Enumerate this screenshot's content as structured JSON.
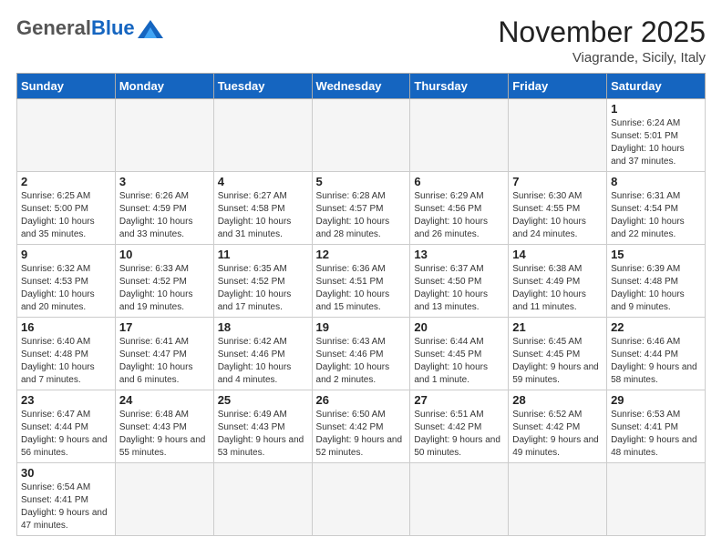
{
  "header": {
    "logo_general": "General",
    "logo_blue": "Blue",
    "month_title": "November 2025",
    "location": "Viagrande, Sicily, Italy"
  },
  "weekdays": [
    "Sunday",
    "Monday",
    "Tuesday",
    "Wednesday",
    "Thursday",
    "Friday",
    "Saturday"
  ],
  "weeks": [
    [
      {
        "day": "",
        "info": ""
      },
      {
        "day": "",
        "info": ""
      },
      {
        "day": "",
        "info": ""
      },
      {
        "day": "",
        "info": ""
      },
      {
        "day": "",
        "info": ""
      },
      {
        "day": "",
        "info": ""
      },
      {
        "day": "1",
        "info": "Sunrise: 6:24 AM\nSunset: 5:01 PM\nDaylight: 10 hours\nand 37 minutes."
      }
    ],
    [
      {
        "day": "2",
        "info": "Sunrise: 6:25 AM\nSunset: 5:00 PM\nDaylight: 10 hours\nand 35 minutes."
      },
      {
        "day": "3",
        "info": "Sunrise: 6:26 AM\nSunset: 4:59 PM\nDaylight: 10 hours\nand 33 minutes."
      },
      {
        "day": "4",
        "info": "Sunrise: 6:27 AM\nSunset: 4:58 PM\nDaylight: 10 hours\nand 31 minutes."
      },
      {
        "day": "5",
        "info": "Sunrise: 6:28 AM\nSunset: 4:57 PM\nDaylight: 10 hours\nand 28 minutes."
      },
      {
        "day": "6",
        "info": "Sunrise: 6:29 AM\nSunset: 4:56 PM\nDaylight: 10 hours\nand 26 minutes."
      },
      {
        "day": "7",
        "info": "Sunrise: 6:30 AM\nSunset: 4:55 PM\nDaylight: 10 hours\nand 24 minutes."
      },
      {
        "day": "8",
        "info": "Sunrise: 6:31 AM\nSunset: 4:54 PM\nDaylight: 10 hours\nand 22 minutes."
      }
    ],
    [
      {
        "day": "9",
        "info": "Sunrise: 6:32 AM\nSunset: 4:53 PM\nDaylight: 10 hours\nand 20 minutes."
      },
      {
        "day": "10",
        "info": "Sunrise: 6:33 AM\nSunset: 4:52 PM\nDaylight: 10 hours\nand 19 minutes."
      },
      {
        "day": "11",
        "info": "Sunrise: 6:35 AM\nSunset: 4:52 PM\nDaylight: 10 hours\nand 17 minutes."
      },
      {
        "day": "12",
        "info": "Sunrise: 6:36 AM\nSunset: 4:51 PM\nDaylight: 10 hours\nand 15 minutes."
      },
      {
        "day": "13",
        "info": "Sunrise: 6:37 AM\nSunset: 4:50 PM\nDaylight: 10 hours\nand 13 minutes."
      },
      {
        "day": "14",
        "info": "Sunrise: 6:38 AM\nSunset: 4:49 PM\nDaylight: 10 hours\nand 11 minutes."
      },
      {
        "day": "15",
        "info": "Sunrise: 6:39 AM\nSunset: 4:48 PM\nDaylight: 10 hours\nand 9 minutes."
      }
    ],
    [
      {
        "day": "16",
        "info": "Sunrise: 6:40 AM\nSunset: 4:48 PM\nDaylight: 10 hours\nand 7 minutes."
      },
      {
        "day": "17",
        "info": "Sunrise: 6:41 AM\nSunset: 4:47 PM\nDaylight: 10 hours\nand 6 minutes."
      },
      {
        "day": "18",
        "info": "Sunrise: 6:42 AM\nSunset: 4:46 PM\nDaylight: 10 hours\nand 4 minutes."
      },
      {
        "day": "19",
        "info": "Sunrise: 6:43 AM\nSunset: 4:46 PM\nDaylight: 10 hours\nand 2 minutes."
      },
      {
        "day": "20",
        "info": "Sunrise: 6:44 AM\nSunset: 4:45 PM\nDaylight: 10 hours\nand 1 minute."
      },
      {
        "day": "21",
        "info": "Sunrise: 6:45 AM\nSunset: 4:45 PM\nDaylight: 9 hours\nand 59 minutes."
      },
      {
        "day": "22",
        "info": "Sunrise: 6:46 AM\nSunset: 4:44 PM\nDaylight: 9 hours\nand 58 minutes."
      }
    ],
    [
      {
        "day": "23",
        "info": "Sunrise: 6:47 AM\nSunset: 4:44 PM\nDaylight: 9 hours\nand 56 minutes."
      },
      {
        "day": "24",
        "info": "Sunrise: 6:48 AM\nSunset: 4:43 PM\nDaylight: 9 hours\nand 55 minutes."
      },
      {
        "day": "25",
        "info": "Sunrise: 6:49 AM\nSunset: 4:43 PM\nDaylight: 9 hours\nand 53 minutes."
      },
      {
        "day": "26",
        "info": "Sunrise: 6:50 AM\nSunset: 4:42 PM\nDaylight: 9 hours\nand 52 minutes."
      },
      {
        "day": "27",
        "info": "Sunrise: 6:51 AM\nSunset: 4:42 PM\nDaylight: 9 hours\nand 50 minutes."
      },
      {
        "day": "28",
        "info": "Sunrise: 6:52 AM\nSunset: 4:42 PM\nDaylight: 9 hours\nand 49 minutes."
      },
      {
        "day": "29",
        "info": "Sunrise: 6:53 AM\nSunset: 4:41 PM\nDaylight: 9 hours\nand 48 minutes."
      }
    ],
    [
      {
        "day": "30",
        "info": "Sunrise: 6:54 AM\nSunset: 4:41 PM\nDaylight: 9 hours\nand 47 minutes."
      },
      {
        "day": "",
        "info": ""
      },
      {
        "day": "",
        "info": ""
      },
      {
        "day": "",
        "info": ""
      },
      {
        "day": "",
        "info": ""
      },
      {
        "day": "",
        "info": ""
      },
      {
        "day": "",
        "info": ""
      }
    ]
  ]
}
